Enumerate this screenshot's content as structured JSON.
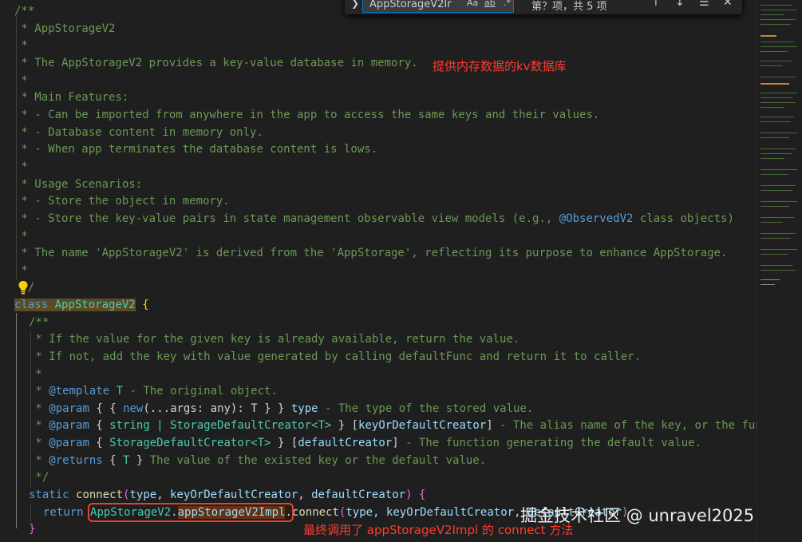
{
  "find_widget": {
    "search_text": "AppStorageV2Ir",
    "match_case_label": "Aa",
    "whole_word_label": "ab",
    "regex_label": ".*",
    "result_count": "第？项，共 5 项",
    "prev_icon": "arrow-up-icon",
    "next_icon": "arrow-down-icon",
    "selection_icon": "find-in-selection-icon",
    "close_icon": "close-icon"
  },
  "code": {
    "l1": "/**",
    "l2": " * AppStorageV2",
    "l3": " *",
    "l4": " * The AppStorageV2 provides a key-value database in memory.",
    "l5": " *",
    "l6": " * Main Features:",
    "l7": " * - Can be imported from anywhere in the app to access the same keys and their values.",
    "l8": " * - Database content in memory only.",
    "l9": " * - When app terminates the database content is lows.",
    "l10": " *",
    "l11": " * Usage Scenarios:",
    "l12": " * - Store the object in memory.",
    "l13a": " * - Store the key-value pairs in state management observable view models (e.g., ",
    "l13b": "@ObservedV2",
    "l13c": " class objects)",
    "l14": " *",
    "l15": " * The name 'AppStorageV2' is derived from the 'AppStorage', reflecting its purpose to enhance AppStorage.",
    "l16": " *",
    "l17": "/",
    "l18_kw": "class",
    "l18_name": "AppStorageV2",
    "l18_brace": "{",
    "l19": "/**",
    "l20": " * If the value for the given key is already available, return the value.",
    "l21": " * If not, add the key with value generated by calling defaultFunc and return it to caller.",
    "l22": " *",
    "l23_tag": "@template",
    "l23_type": "T",
    "l23_desc": " - The original object.",
    "l24_tag": "@param",
    "l24_o1": "{",
    "l24_o2": "{",
    "l24_new": "new",
    "l24_args": "(...args: any): T",
    "l24_c1": "}",
    "l24_c2": "}",
    "l24_name": "type",
    "l24_desc": " - The type of the stored value.",
    "l25_tag": "@param",
    "l25_type": "string | StorageDefaultCreator<T>",
    "l25_name": "keyOrDefaultCreator",
    "l25_desc": " - The alias name of the key, or the function generating the default value.",
    "l26_tag": "@param",
    "l26_type": "StorageDefaultCreator<T>",
    "l26_name": "defaultCreator",
    "l26_desc": " - The function generating the default value.",
    "l27_tag": "@returns",
    "l27_type": "T",
    "l27_desc": " The value of the existed key or the default value.",
    "l28": " */",
    "l29_kw": "static",
    "l29_fn": "connect",
    "l29_p1": "type",
    "l29_p2": "keyOrDefaultCreator",
    "l29_p3": "defaultCreator",
    "l30_kw": "return",
    "l30_obj": "AppStorageV2",
    "l30_prop": "appStorageV2Impl",
    "l30_call": "connect",
    "l30_args": "type, keyOrDefaultCreator, defaultCreator",
    "l31": "}"
  },
  "annotations": {
    "kv_note": "提供内存数据的kv数据库",
    "connect_note": "最终调用了 appStorageV2Impl 的 connect 方法",
    "bulb_icon": "lightbulb-icon"
  },
  "watermark": "掘金技术社区 @ unravel2025",
  "colors": {
    "editor_bg": "#1f1f1f",
    "comment": "#6a9955",
    "keyword": "#569cd6",
    "type": "#4ec9b0",
    "annotation_red": "#ff3b30"
  }
}
